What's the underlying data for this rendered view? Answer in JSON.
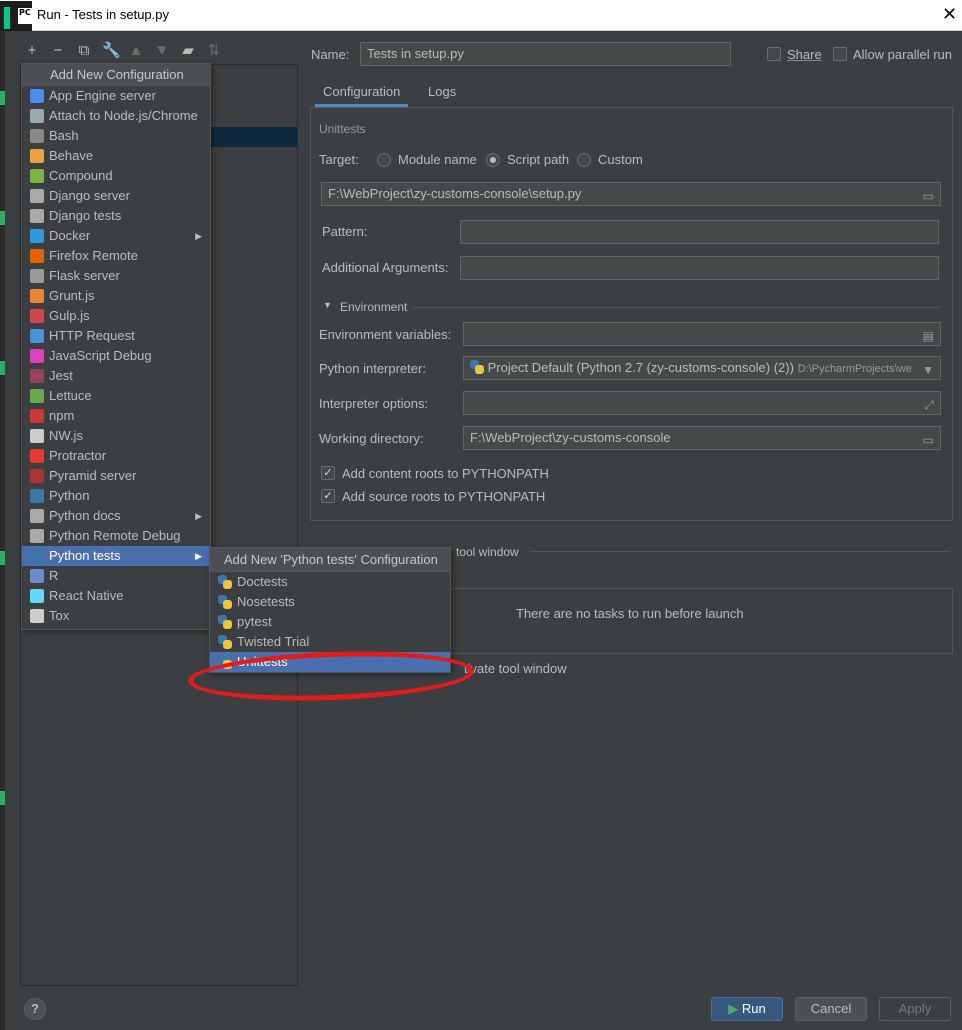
{
  "window": {
    "title": "Run - Tests in setup.py",
    "app_icon_text": "PC"
  },
  "add_menu": {
    "header": "Add New Configuration",
    "items": [
      {
        "label": "App Engine server",
        "icon": "app-engine-icon",
        "color": "#4a8af4"
      },
      {
        "label": "Attach to Node.js/Chrome",
        "icon": "attach-node-icon",
        "color": "#9aa"
      },
      {
        "label": "Bash",
        "icon": "bash-icon",
        "color": "#888"
      },
      {
        "label": "Behave",
        "icon": "behave-icon",
        "color": "#e8a33c"
      },
      {
        "label": "Compound",
        "icon": "compound-icon",
        "color": "#7cb342"
      },
      {
        "label": "Django server",
        "icon": "django-server-icon",
        "color": "#aaa"
      },
      {
        "label": "Django tests",
        "icon": "django-tests-icon",
        "color": "#aaa"
      },
      {
        "label": "Docker",
        "icon": "docker-icon",
        "color": "#2d9ae0",
        "submenu": true
      },
      {
        "label": "Firefox Remote",
        "icon": "firefox-icon",
        "color": "#e66000"
      },
      {
        "label": "Flask server",
        "icon": "flask-icon",
        "color": "#999"
      },
      {
        "label": "Grunt.js",
        "icon": "grunt-icon",
        "color": "#e48632"
      },
      {
        "label": "Gulp.js",
        "icon": "gulp-icon",
        "color": "#cf4647"
      },
      {
        "label": "HTTP Request",
        "icon": "http-request-icon",
        "color": "#4a90d9"
      },
      {
        "label": "JavaScript Debug",
        "icon": "js-debug-icon",
        "color": "#d4b"
      },
      {
        "label": "Jest",
        "icon": "jest-icon",
        "color": "#99425b"
      },
      {
        "label": "Lettuce",
        "icon": "lettuce-icon",
        "color": "#6aa84f"
      },
      {
        "label": "npm",
        "icon": "npm-icon",
        "color": "#cb3837"
      },
      {
        "label": "NW.js",
        "icon": "nwjs-icon",
        "color": "#ccc"
      },
      {
        "label": "Protractor",
        "icon": "protractor-icon",
        "color": "#e53935"
      },
      {
        "label": "Pyramid server",
        "icon": "pyramid-icon",
        "color": "#a33"
      },
      {
        "label": "Python",
        "icon": "python-icon",
        "color": "#3b77a8"
      },
      {
        "label": "Python docs",
        "icon": "python-docs-icon",
        "color": "#aaa",
        "submenu": true
      },
      {
        "label": "Python Remote Debug",
        "icon": "python-remote-debug-icon",
        "color": "#aaa"
      },
      {
        "label": "Python tests",
        "icon": "python-tests-icon",
        "color": "#3b77a8",
        "submenu": true,
        "selected": true
      },
      {
        "label": "R",
        "icon": "r-icon",
        "color": "#6d8dc8"
      },
      {
        "label": "React Native",
        "icon": "react-native-icon",
        "color": "#61dafb"
      },
      {
        "label": "Tox",
        "icon": "tox-icon",
        "color": "#ccc"
      }
    ]
  },
  "sub_menu": {
    "header": "Add New 'Python tests' Configuration",
    "items": [
      {
        "label": "Doctests"
      },
      {
        "label": "Nosetests"
      },
      {
        "label": "pytest"
      },
      {
        "label": "Twisted Trial"
      },
      {
        "label": "Unittests",
        "selected": true
      }
    ]
  },
  "form": {
    "name_label": "Name:",
    "name_value": "Tests in setup.py",
    "share_label": "Share",
    "allow_parallel_label": "Allow parallel run",
    "tabs": [
      "Configuration",
      "Logs"
    ],
    "group_title": "Unittests",
    "target_label": "Target:",
    "target_options": [
      "Module name",
      "Script path",
      "Custom"
    ],
    "target_selected": "Script path",
    "script_path": "F:\\WebProject\\zy-customs-console\\setup.py",
    "pattern_label": "Pattern:",
    "pattern_value": "",
    "additional_args_label": "Additional Arguments:",
    "additional_args_value": "",
    "environment_title": "Environment",
    "env_vars_label": "Environment variables:",
    "env_vars_value": "",
    "interpreter_label": "Python interpreter:",
    "interpreter_value": "Project Default (Python 2.7 (zy-customs-console) (2))",
    "interpreter_path": "D:\\PycharmProjects\\we",
    "interp_options_label": "Interpreter options:",
    "interp_options_value": "",
    "working_dir_label": "Working directory:",
    "working_dir_value": "F:\\WebProject\\zy-customs-console",
    "add_content_roots": "Add content roots to PYTHONPATH",
    "add_source_roots": "Add source roots to PYTHONPATH",
    "before_launch_fragment": "tool window",
    "no_tasks": "There are no tasks to run before launch",
    "activate_fragment": "tivate tool window"
  },
  "buttons": {
    "run": "Run",
    "cancel": "Cancel",
    "apply": "Apply",
    "help": "?"
  },
  "colors": {
    "background": "#3c3f41",
    "selection": "#4b6eaf",
    "primary_button": "#365880",
    "annotation_red": "#e21b1b"
  }
}
